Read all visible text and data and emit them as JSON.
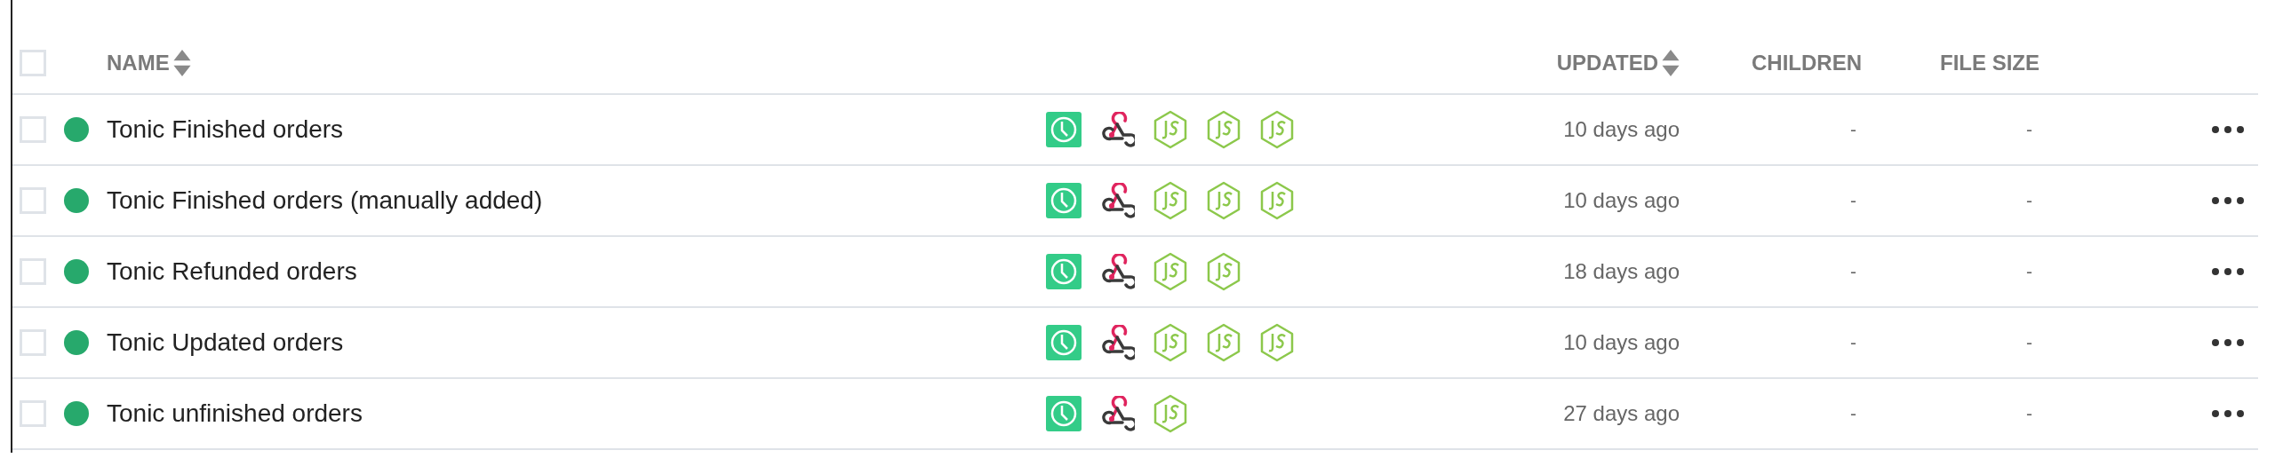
{
  "header": {
    "select_all": {
      "checked": false
    },
    "columns": [
      {
        "label": "NAME",
        "sortable": true
      },
      {
        "label": "UPDATED",
        "sortable": true
      },
      {
        "label": "CHILDREN",
        "sortable": false
      },
      {
        "label": "FILE SIZE",
        "sortable": false
      }
    ]
  },
  "rows": [
    {
      "checked": false,
      "color": "#27a96c",
      "name": "Tonic Finished orders",
      "icons": [
        {
          "kind": "schedule"
        },
        {
          "kind": "webhook"
        },
        {
          "kind": "node"
        },
        {
          "kind": "node"
        },
        {
          "kind": "node"
        }
      ],
      "updated": "10 days ago",
      "children": "-",
      "file_size": "-"
    },
    {
      "checked": false,
      "color": "#27a96c",
      "name": "Tonic Finished orders (manually added)",
      "icons": [
        {
          "kind": "schedule"
        },
        {
          "kind": "webhook"
        },
        {
          "kind": "node"
        },
        {
          "kind": "node"
        },
        {
          "kind": "node"
        }
      ],
      "updated": "10 days ago",
      "children": "-",
      "file_size": "-"
    },
    {
      "checked": false,
      "color": "#27a96c",
      "name": "Tonic Refunded orders",
      "icons": [
        {
          "kind": "schedule"
        },
        {
          "kind": "webhook"
        },
        {
          "kind": "node"
        },
        {
          "kind": "node"
        }
      ],
      "updated": "18 days ago",
      "children": "-",
      "file_size": "-"
    },
    {
      "checked": false,
      "color": "#27a96c",
      "name": "Tonic Updated orders",
      "icons": [
        {
          "kind": "schedule"
        },
        {
          "kind": "webhook"
        },
        {
          "kind": "node"
        },
        {
          "kind": "node"
        },
        {
          "kind": "node"
        }
      ],
      "updated": "10 days ago",
      "children": "-",
      "file_size": "-"
    },
    {
      "checked": false,
      "color": "#27a96c",
      "name": "Tonic unfinished orders",
      "icons": [
        {
          "kind": "schedule"
        },
        {
          "kind": "webhook"
        },
        {
          "kind": "node"
        }
      ],
      "updated": "27 days ago",
      "children": "-",
      "file_size": "-"
    }
  ]
}
